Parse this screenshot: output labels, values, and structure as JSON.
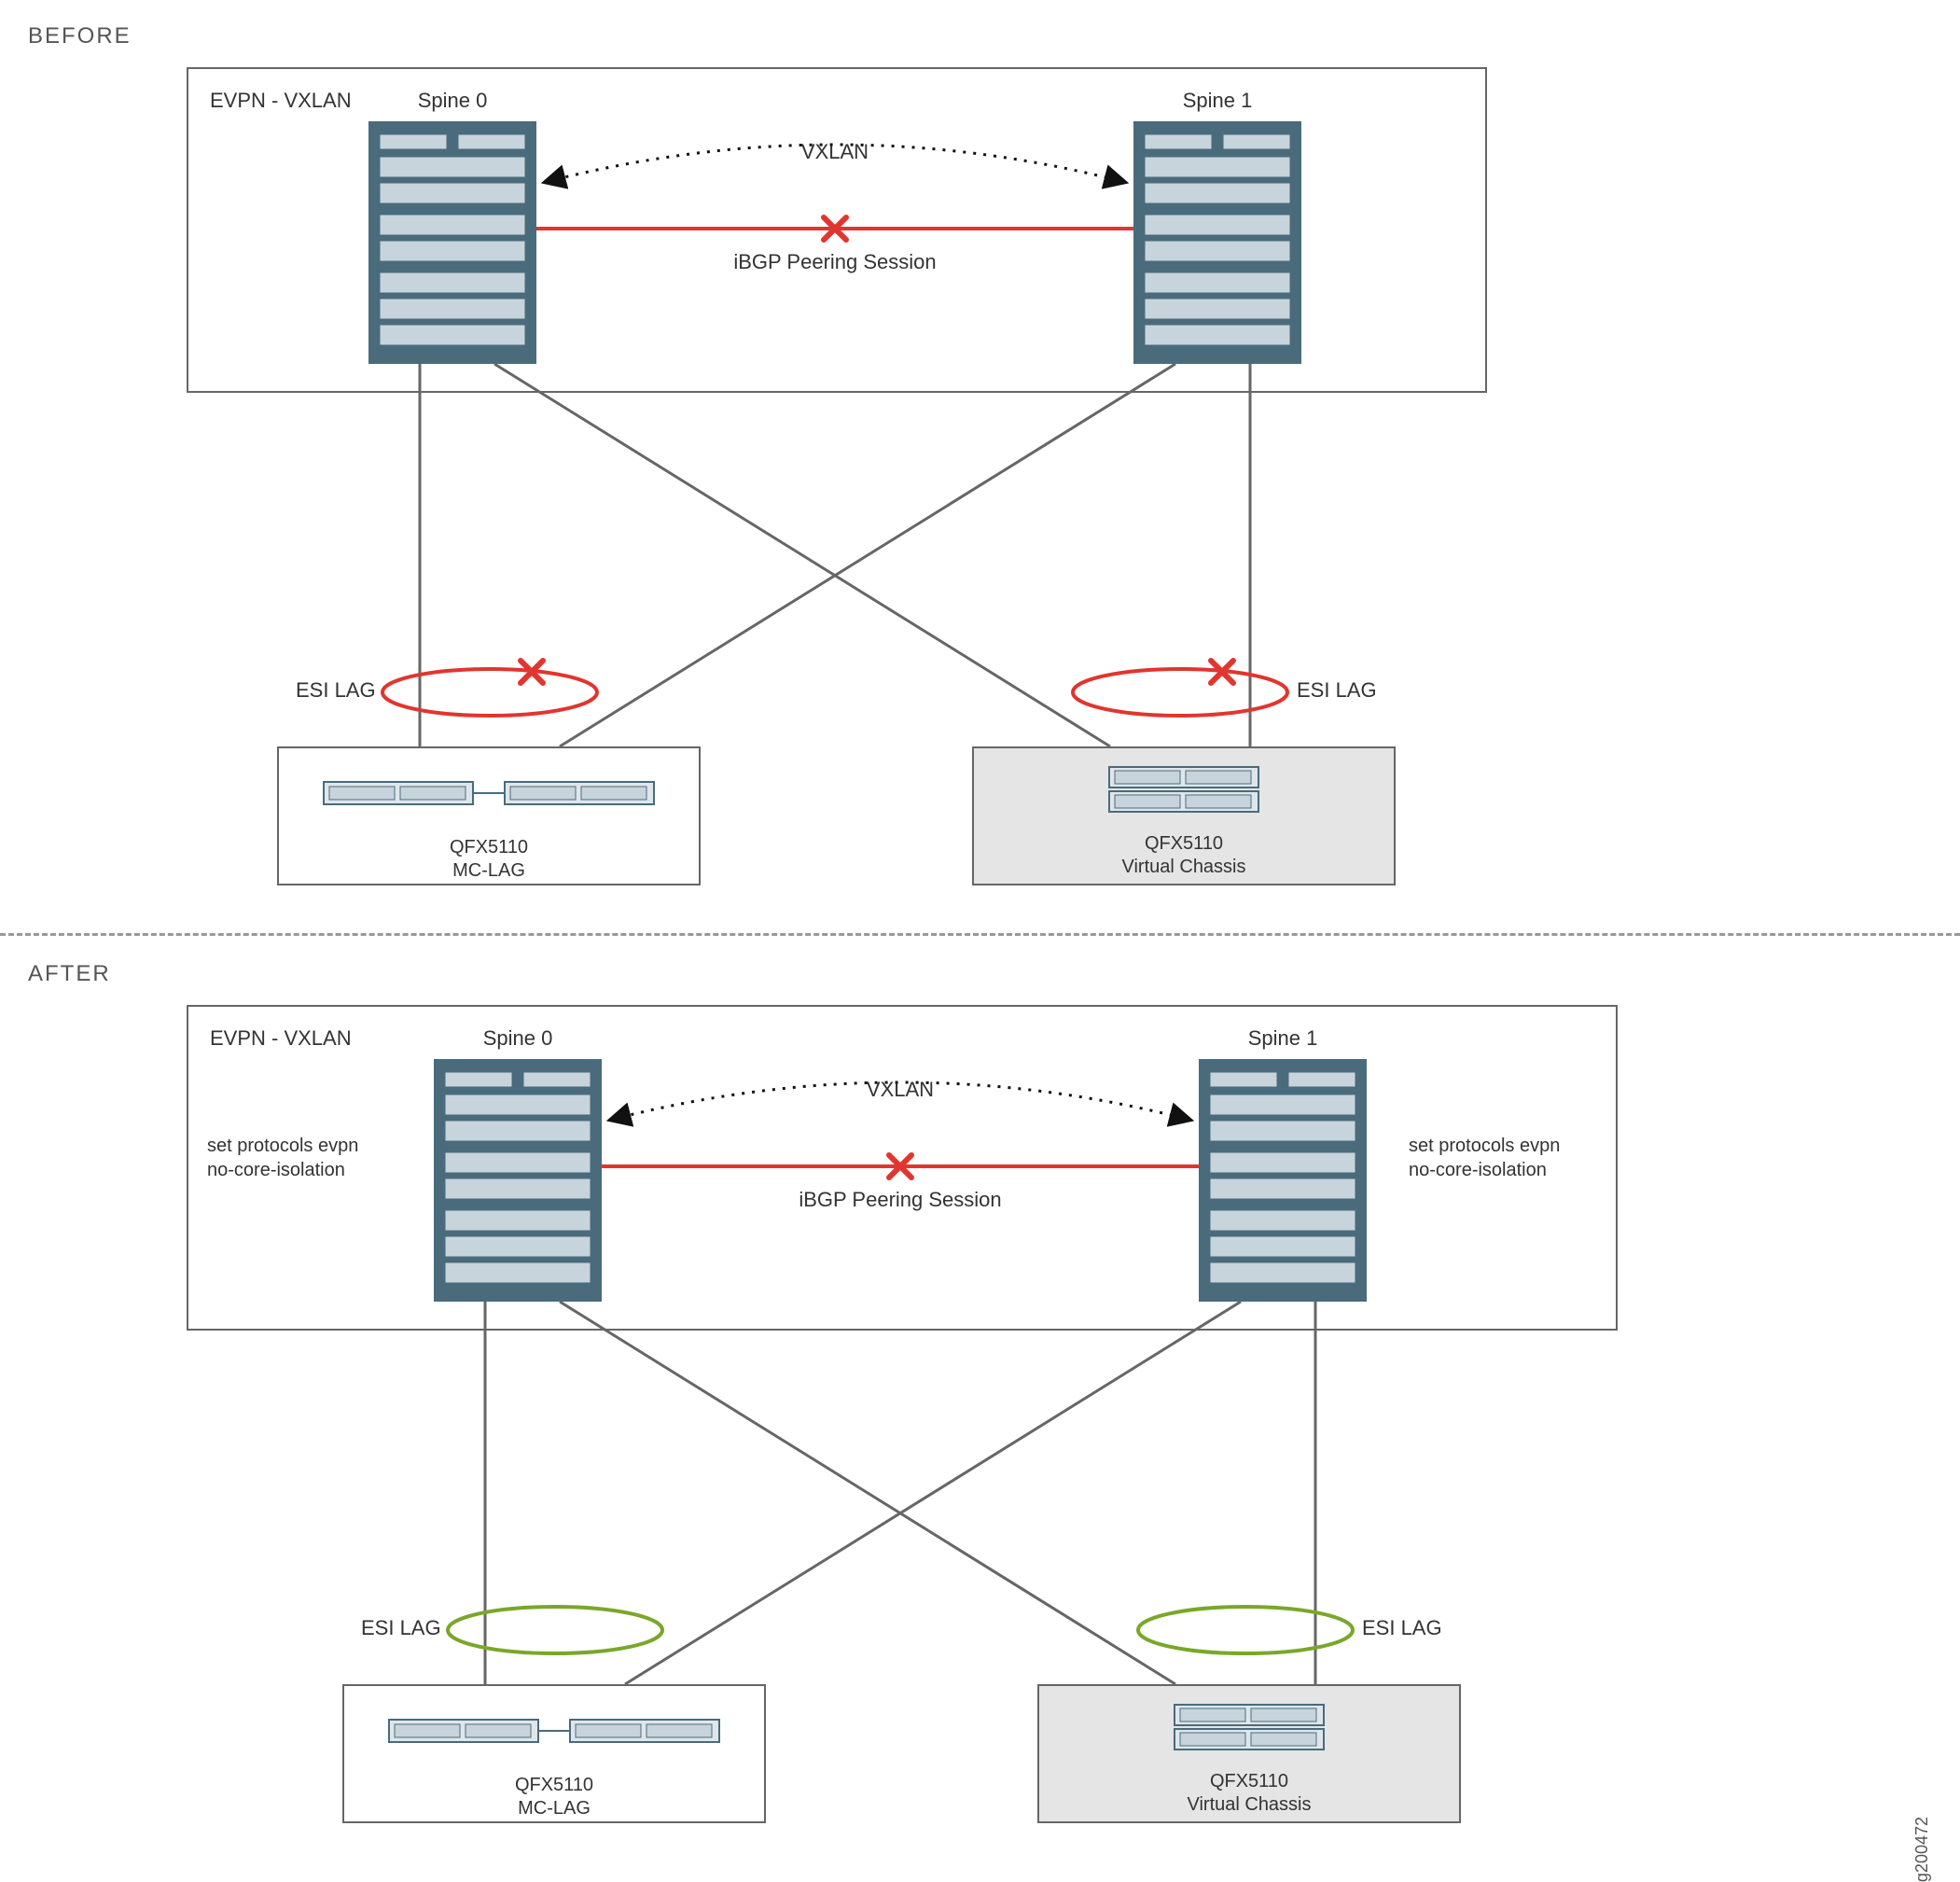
{
  "labels": {
    "before": "BEFORE",
    "after": "AFTER",
    "evpn_box": "EVPN - VXLAN",
    "spine0": "Spine 0",
    "spine1": "Spine 1",
    "vxlan": "VXLAN",
    "ibgp": "iBGP Peering Session",
    "esi_lag": "ESI LAG",
    "config_line1": "set protocols evpn",
    "config_line2": "no-core-isolation",
    "leaf_mclag_name": "QFX5110",
    "leaf_mclag_sub": "MC-LAG",
    "leaf_vc_name": "QFX5110",
    "leaf_vc_sub": "Virtual Chassis",
    "figure_id": "g200472"
  },
  "diagram": {
    "description": "Two-panel network diagram showing core isolation behavior before and after applying no-core-isolation.",
    "panels": [
      {
        "title": "BEFORE",
        "container": "EVPN - VXLAN",
        "spines": [
          "Spine 0",
          "Spine 1"
        ],
        "spine_links": [
          {
            "label": "VXLAN",
            "style": "dotted-arc",
            "status": "up"
          },
          {
            "label": "iBGP Peering Session",
            "style": "solid",
            "status": "down",
            "marker": "red-x"
          }
        ],
        "leaf_devices": [
          {
            "model": "QFX5110",
            "mode": "MC-LAG",
            "shaded": false
          },
          {
            "model": "QFX5110",
            "mode": "Virtual Chassis",
            "shaded": true
          }
        ],
        "leaf_uplinks": {
          "topology": "full-mesh cross-connect from each leaf to both spines",
          "grouping": "ESI LAG",
          "status": "down",
          "ellipse_color": "red",
          "marker": "red-x"
        }
      },
      {
        "title": "AFTER",
        "container": "EVPN - VXLAN",
        "spines": [
          "Spine 0",
          "Spine 1"
        ],
        "spine_config": [
          "set protocols evpn",
          "no-core-isolation"
        ],
        "spine_links": [
          {
            "label": "VXLAN",
            "style": "dotted-arc",
            "status": "up"
          },
          {
            "label": "iBGP Peering Session",
            "style": "solid",
            "status": "down",
            "marker": "red-x"
          }
        ],
        "leaf_devices": [
          {
            "model": "QFX5110",
            "mode": "MC-LAG",
            "shaded": false
          },
          {
            "model": "QFX5110",
            "mode": "Virtual Chassis",
            "shaded": true
          }
        ],
        "leaf_uplinks": {
          "topology": "full-mesh cross-connect from each leaf to both spines",
          "grouping": "ESI LAG",
          "status": "up",
          "ellipse_color": "green",
          "marker": null
        }
      }
    ]
  }
}
